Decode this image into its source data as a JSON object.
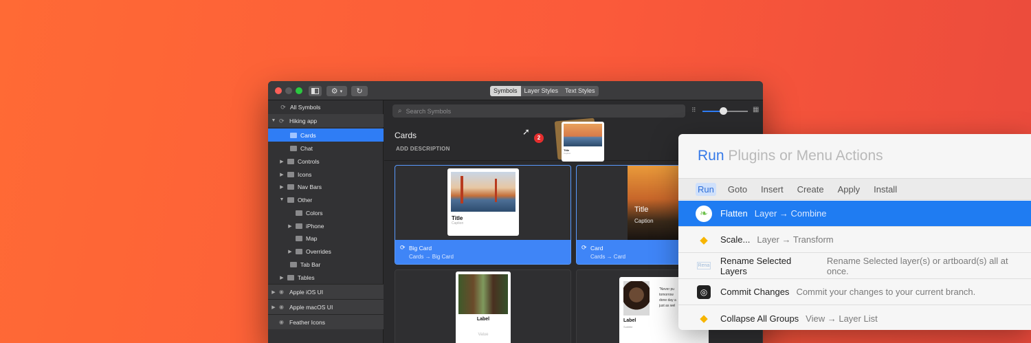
{
  "window": {
    "segments": [
      "Symbols",
      "Layer Styles",
      "Text Styles"
    ],
    "sidebar": [
      {
        "label": "All Symbols"
      },
      {
        "label": "Hiking app"
      },
      {
        "label": "Cards"
      },
      {
        "label": "Chat"
      },
      {
        "label": "Controls"
      },
      {
        "label": "Icons"
      },
      {
        "label": "Nav Bars"
      },
      {
        "label": "Other"
      },
      {
        "label": "Colors"
      },
      {
        "label": "iPhone"
      },
      {
        "label": "Map"
      },
      {
        "label": "Overrides"
      },
      {
        "label": "Tab Bar"
      },
      {
        "label": "Tables"
      },
      {
        "label": "Apple iOS UI"
      },
      {
        "label": "Apple macOS UI"
      },
      {
        "label": "Feather Icons"
      }
    ],
    "search_placeholder": "Search Symbols",
    "section_title": "Cards",
    "add_description": "ADD DESCRIPTION",
    "drag_badge": "2",
    "drag_preview": {
      "title": "Title",
      "caption": "Caption"
    },
    "cards": [
      {
        "name": "Big Card",
        "path": "Cards → Big Card",
        "preview_title": "Title",
        "preview_caption": "Caption"
      },
      {
        "name": "Card",
        "path": "Cards → Card",
        "preview_title": "Title",
        "preview_caption": "Caption"
      },
      {
        "preview_title": "Label",
        "preview_caption": "Value"
      },
      {
        "preview_title": "Label",
        "preview_caption": "Subtitle",
        "quote": "\"Never pu\ntomorrow \ndone day a\njust as wel"
      }
    ]
  },
  "panel": {
    "title_run": "Run",
    "title_rest": " Plugins or Menu Actions",
    "tabs": [
      "Run",
      "Goto",
      "Insert",
      "Create",
      "Apply",
      "Install"
    ],
    "rows": [
      {
        "title": "Flatten",
        "sub": "Layer → Combine",
        "icon": "plugin-leaf-icon"
      },
      {
        "title": "Scale...",
        "sub": "Layer → Transform",
        "icon": "sketch-diamond-icon"
      },
      {
        "title": "Rename Selected Layers",
        "sub": "Rename Selected layer(s) or artboard(s) all at once.",
        "icon": "rename-icon"
      },
      {
        "title": "Commit Changes",
        "sub": "Commit your changes to your current branch.",
        "icon": "git-commit-icon"
      },
      {
        "title": "Collapse All Groups",
        "sub": "View → Layer List",
        "icon": "sketch-diamond-icon"
      }
    ]
  },
  "colors": {
    "accent": "#2f7df5",
    "highlight": "#1f7cf2"
  }
}
